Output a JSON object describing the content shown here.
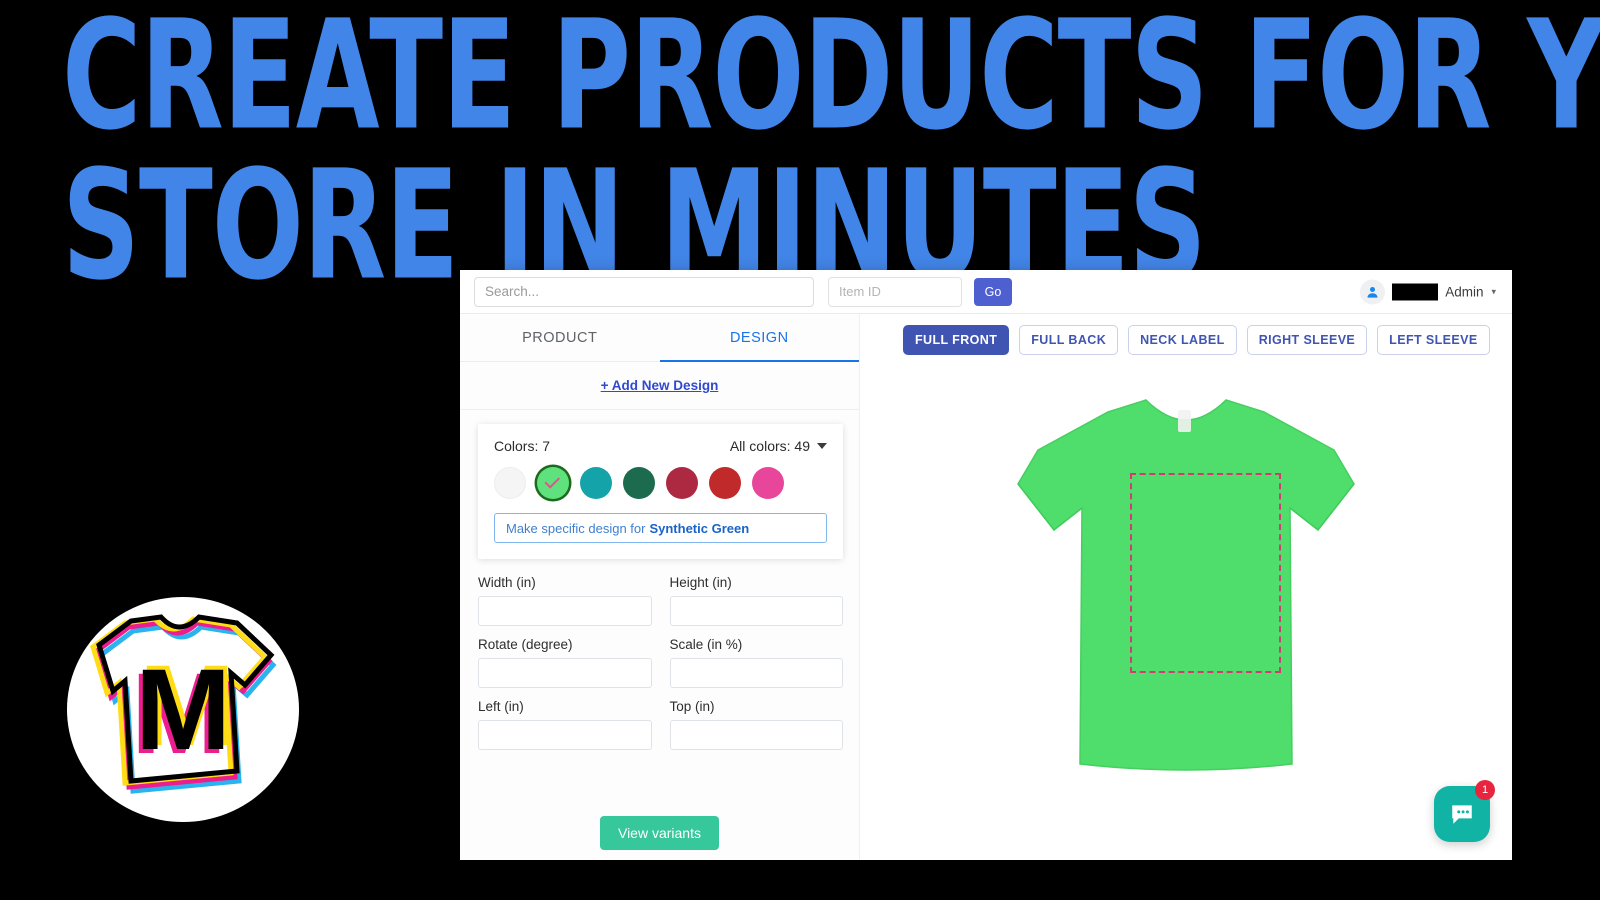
{
  "hero": {
    "headline_line1": "Create products for your",
    "headline_line2": "Store in minutes",
    "headline_color": "#4285e8",
    "background_color": "#000000",
    "logo_letter": "M",
    "logo_name": "cmyk-tshirt-logo"
  },
  "header": {
    "search_placeholder": "Search...",
    "search_value": "",
    "item_id_placeholder": "Item ID",
    "item_id_value": "",
    "go_label": "Go",
    "account_name": "Admin",
    "account_redacted": true,
    "avatar_icon": "user-icon",
    "caret_icon": "chevron-down-icon"
  },
  "tabs": [
    {
      "label": "PRODUCT",
      "active": false
    },
    {
      "label": "DESIGN",
      "active": true
    }
  ],
  "design_panel": {
    "add_new_design_label": "+ Add New Design",
    "colors_count_label": "Colors: 7",
    "all_colors_label": "All colors: 49",
    "all_colors_caret": "caret-down-icon",
    "swatches": [
      {
        "name": "white",
        "hex": "#f5f5f5",
        "selected": false
      },
      {
        "name": "synthetic-green",
        "hex": "#5fe27e",
        "selected": true
      },
      {
        "name": "teal",
        "hex": "#14a3a8",
        "selected": false
      },
      {
        "name": "forest-green",
        "hex": "#1d6b4f",
        "selected": false
      },
      {
        "name": "crimson",
        "hex": "#ad2942",
        "selected": false
      },
      {
        "name": "red",
        "hex": "#c02a2a",
        "selected": false
      },
      {
        "name": "pink",
        "hex": "#e8469a",
        "selected": false
      }
    ],
    "selected_check_color": "#e0548f",
    "selected_ring_color": "#1c6b1c",
    "specific_design_prefix": "Make specific design for",
    "specific_design_color": "Synthetic Green",
    "fields": [
      {
        "label": "Width (in)",
        "value": "",
        "name": "width-input"
      },
      {
        "label": "Height (in)",
        "value": "",
        "name": "height-input"
      },
      {
        "label": "Rotate (degree)",
        "value": "",
        "name": "rotate-input"
      },
      {
        "label": "Scale (in %)",
        "value": "",
        "name": "scale-input"
      },
      {
        "label": "Left (in)",
        "value": "",
        "name": "left-input"
      },
      {
        "label": "Top (in)",
        "value": "",
        "name": "top-input"
      }
    ],
    "view_variants_label": "View variants",
    "view_variants_color": "#36c79a"
  },
  "preview": {
    "view_tabs": [
      {
        "label": "FULL FRONT",
        "active": true
      },
      {
        "label": "FULL BACK",
        "active": false
      },
      {
        "label": "NECK LABEL",
        "active": false
      },
      {
        "label": "RIGHT SLEEVE",
        "active": false
      },
      {
        "label": "LEFT SLEEVE",
        "active": false
      }
    ],
    "shirt_color": "#4fdd6b",
    "print_area_border_color": "#d33b72",
    "product_name": "t-shirt-front-preview"
  },
  "chat": {
    "badge_count": "1",
    "icon": "chat-bubble-icon",
    "color": "#11b3a5",
    "badge_color": "#e8253f"
  }
}
